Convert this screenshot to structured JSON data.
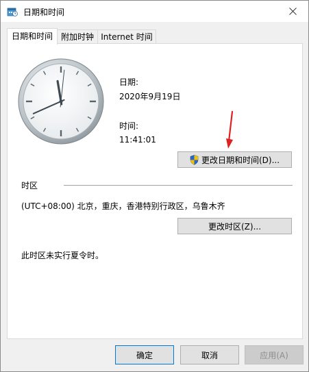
{
  "window": {
    "title": "日期和时间"
  },
  "tabs": [
    {
      "label": "日期和时间",
      "active": true
    },
    {
      "label": "附加时钟",
      "active": false
    },
    {
      "label": "Internet 时间",
      "active": false
    }
  ],
  "date_section": {
    "date_label": "日期:",
    "date_value": "2020年9月19日",
    "time_label": "时间:",
    "time_value": "11:41:01",
    "change_button": "更改日期和时间(D)..."
  },
  "timezone_section": {
    "heading": "时区",
    "value": "(UTC+08:00) 北京，重庆，香港特别行政区，乌鲁木齐",
    "change_button": "更改时区(Z)...",
    "dst_note": "此时区未实行夏令时。"
  },
  "footer": {
    "ok_label": "确定",
    "cancel_label": "取消",
    "apply_label": "应用(A)"
  },
  "clock": {
    "hours": 11,
    "minutes": 41,
    "seconds": 1
  },
  "colors": {
    "annotation_arrow": "#e02020",
    "shield_blue": "#2a66c9",
    "shield_yellow": "#f2c200"
  }
}
